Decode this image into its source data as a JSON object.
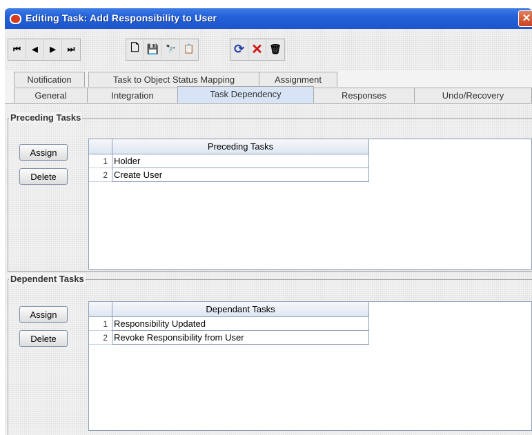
{
  "window": {
    "title": "Editing Task: Add Responsibility to User",
    "close_glyph": "✕"
  },
  "toolbar": {
    "buttons": [
      {
        "icon": "first-record-icon",
        "glyph": "⏮"
      },
      {
        "icon": "previous-record-icon",
        "glyph": "◀"
      },
      {
        "icon": "next-record-icon",
        "glyph": "▶"
      },
      {
        "icon": "last-record-icon",
        "glyph": "⏭"
      },
      {
        "icon": "new-icon",
        "glyph": "🗋"
      },
      {
        "icon": "save-icon",
        "glyph": "💾"
      },
      {
        "icon": "find-icon",
        "glyph": "🔭"
      },
      {
        "icon": "paste-icon",
        "glyph": "📋"
      },
      {
        "icon": "refresh-icon",
        "glyph": "⟳"
      },
      {
        "icon": "cancel-icon",
        "glyph": "✕"
      },
      {
        "icon": "delete-icon",
        "glyph": "🗑"
      }
    ]
  },
  "tabs": {
    "row1": [
      "Notification",
      "Task to Object Status Mapping",
      "Assignment"
    ],
    "row2": [
      "General",
      "Integration",
      "Task Dependency",
      "Responses",
      "Undo/Recovery"
    ],
    "active": "Task Dependency"
  },
  "preceding": {
    "section_title": "Preceding Tasks",
    "assign_label": "Assign",
    "delete_label": "Delete",
    "column_header": "Preceding Tasks",
    "rows": [
      {
        "index": "1",
        "value": "Holder"
      },
      {
        "index": "2",
        "value": "Create User"
      }
    ]
  },
  "dependent": {
    "section_title": "Dependent Tasks",
    "assign_label": "Assign",
    "delete_label": "Delete",
    "column_header": "Dependant Tasks",
    "rows": [
      {
        "index": "1",
        "value": "Responsibility Updated"
      },
      {
        "index": "2",
        "value": "Revoke Responsibility from User"
      }
    ]
  },
  "colors": {
    "titlebar": "#2461d8",
    "active_tab": "#d7e4f5",
    "close": "#c8411f"
  }
}
